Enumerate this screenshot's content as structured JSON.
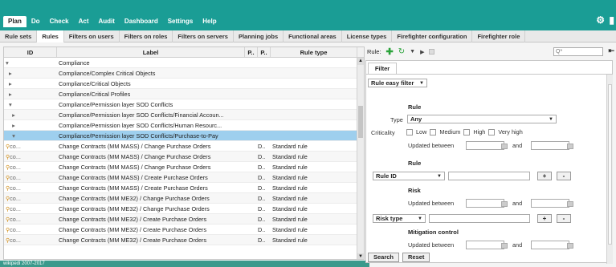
{
  "menu_tabs": [
    "Plan",
    "Do",
    "Check",
    "Act",
    "Audit",
    "Dashboard",
    "Settings",
    "Help"
  ],
  "active_menu": "Plan",
  "sub_tabs": [
    "Rule sets",
    "Rules",
    "Filters on users",
    "Filters on roles",
    "Filters on servers",
    "Planning jobs",
    "Functional areas",
    "License types",
    "Firefighter configuration",
    "Firefighter role"
  ],
  "active_sub": "Rules",
  "grid": {
    "headers": {
      "id": "ID",
      "label": "Label",
      "p1": "P..",
      "p2": "P..",
      "type": "Rule type"
    },
    "rows": [
      {
        "id": "▾",
        "label": "Compliance",
        "p2": "",
        "type": "",
        "kind": "folder"
      },
      {
        "id": "  ▸",
        "label": "Compliance/Complex Critical Objects",
        "p2": "",
        "type": "",
        "kind": "folder"
      },
      {
        "id": "  ▸",
        "label": "Compliance/Critical Objects",
        "p2": "",
        "type": "",
        "kind": "folder"
      },
      {
        "id": "  ▸",
        "label": "Compliance/Critical Profiles",
        "p2": "",
        "type": "",
        "kind": "folder"
      },
      {
        "id": "  ▾",
        "label": "Compliance/Permission layer SOD Conflicts",
        "p2": "",
        "type": "",
        "kind": "folder"
      },
      {
        "id": "    ▸",
        "label": "Compliance/Permission layer SOD Conflicts/Financial Accoun...",
        "p2": "",
        "type": "",
        "kind": "folder"
      },
      {
        "id": "    ▸",
        "label": "Compliance/Permission layer SOD Conflicts/Human Resourc...",
        "p2": "",
        "type": "",
        "kind": "folder"
      },
      {
        "id": "    ▾",
        "label": "Compliance/Permission layer SOD Conflicts/Purchase-to-Pay",
        "p2": "",
        "type": "",
        "kind": "folder",
        "selected": true
      },
      {
        "id": "co...",
        "label": "Change Contracts (MM MASS) / Change Purchase Orders",
        "p2": "D..",
        "type": "Standard rule",
        "kind": "rule"
      },
      {
        "id": "co...",
        "label": "Change Contracts (MM MASS) / Change Purchase Orders",
        "p2": "D..",
        "type": "Standard rule",
        "kind": "rule"
      },
      {
        "id": "co...",
        "label": "Change Contracts (MM MASS) / Change Purchase Orders",
        "p2": "D..",
        "type": "Standard rule",
        "kind": "rule"
      },
      {
        "id": "co...",
        "label": "Change Contracts (MM MASS) / Create Purchase Orders",
        "p2": "D..",
        "type": "Standard rule",
        "kind": "rule"
      },
      {
        "id": "co...",
        "label": "Change Contracts (MM MASS) / Create Purchase Orders",
        "p2": "D..",
        "type": "Standard rule",
        "kind": "rule"
      },
      {
        "id": "co...",
        "label": "Change Contracts (MM ME32) / Change Purchase Orders",
        "p2": "D..",
        "type": "Standard rule",
        "kind": "rule"
      },
      {
        "id": "co...",
        "label": "Change Contracts (MM ME32) / Change Purchase Orders",
        "p2": "D..",
        "type": "Standard rule",
        "kind": "rule"
      },
      {
        "id": "co...",
        "label": "Change Contracts (MM ME32) / Create Purchase Orders",
        "p2": "D..",
        "type": "Standard rule",
        "kind": "rule"
      },
      {
        "id": "co...",
        "label": "Change Contracts (MM ME32) / Create Purchase Orders",
        "p2": "D..",
        "type": "Standard rule",
        "kind": "rule"
      },
      {
        "id": "co...",
        "label": "Change Contracts (MM ME32) / Create Purchase Orders",
        "p2": "D..",
        "type": "Standard rule",
        "kind": "rule"
      }
    ]
  },
  "footer_text": "wikipedi 2007-2017",
  "rule_toolbar": {
    "label": "Rule:",
    "search_value": "Q*"
  },
  "filter": {
    "tab": "Filter",
    "easy_filter": "Rule easy filter",
    "rule_section": "Rule",
    "type_label": "Type",
    "type_value": "Any",
    "criticality_label": "Criticality",
    "criticality_options": [
      "Low",
      "Medium",
      "High",
      "Very high"
    ],
    "updated_between": "Updated between",
    "and": "and",
    "rule_section2": "Rule",
    "rule_id_select": "Rule ID",
    "risk_section": "Risk",
    "risk_type_select": "Risk type",
    "mitigation_section": "Mitigation control",
    "search_btn": "Search",
    "reset_btn": "Reset"
  }
}
